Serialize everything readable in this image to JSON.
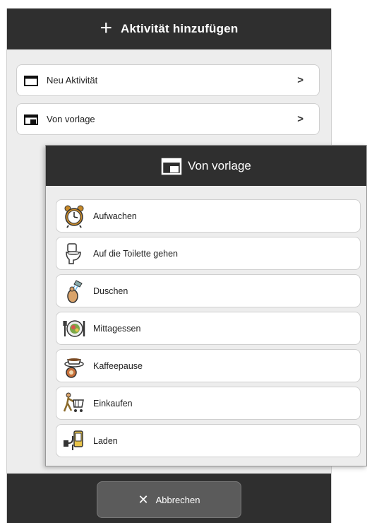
{
  "main": {
    "title": "Aktivität hinzufügen",
    "options": [
      {
        "label": "Neu Aktivität",
        "icon": "calendar-icon"
      },
      {
        "label": "Von vorlage",
        "icon": "calendar-template-icon"
      }
    ],
    "cancel_label": "Abbrechen"
  },
  "template_dialog": {
    "title": "Von vorlage",
    "items": [
      {
        "label": "Aufwachen",
        "icon": "alarm-clock-icon"
      },
      {
        "label": "Auf die Toilette gehen",
        "icon": "toilet-icon"
      },
      {
        "label": "Duschen",
        "icon": "shower-icon"
      },
      {
        "label": "Mittagessen",
        "icon": "lunch-plate-icon"
      },
      {
        "label": "Kaffeepause",
        "icon": "coffee-cup-icon"
      },
      {
        "label": "Einkaufen",
        "icon": "shopping-cart-icon"
      },
      {
        "label": "Laden",
        "icon": "charger-icon"
      }
    ]
  },
  "colors": {
    "header": "#2f2f2f",
    "background": "#ededed",
    "card": "#ffffff",
    "cancel_button": "#5b5b5b"
  }
}
